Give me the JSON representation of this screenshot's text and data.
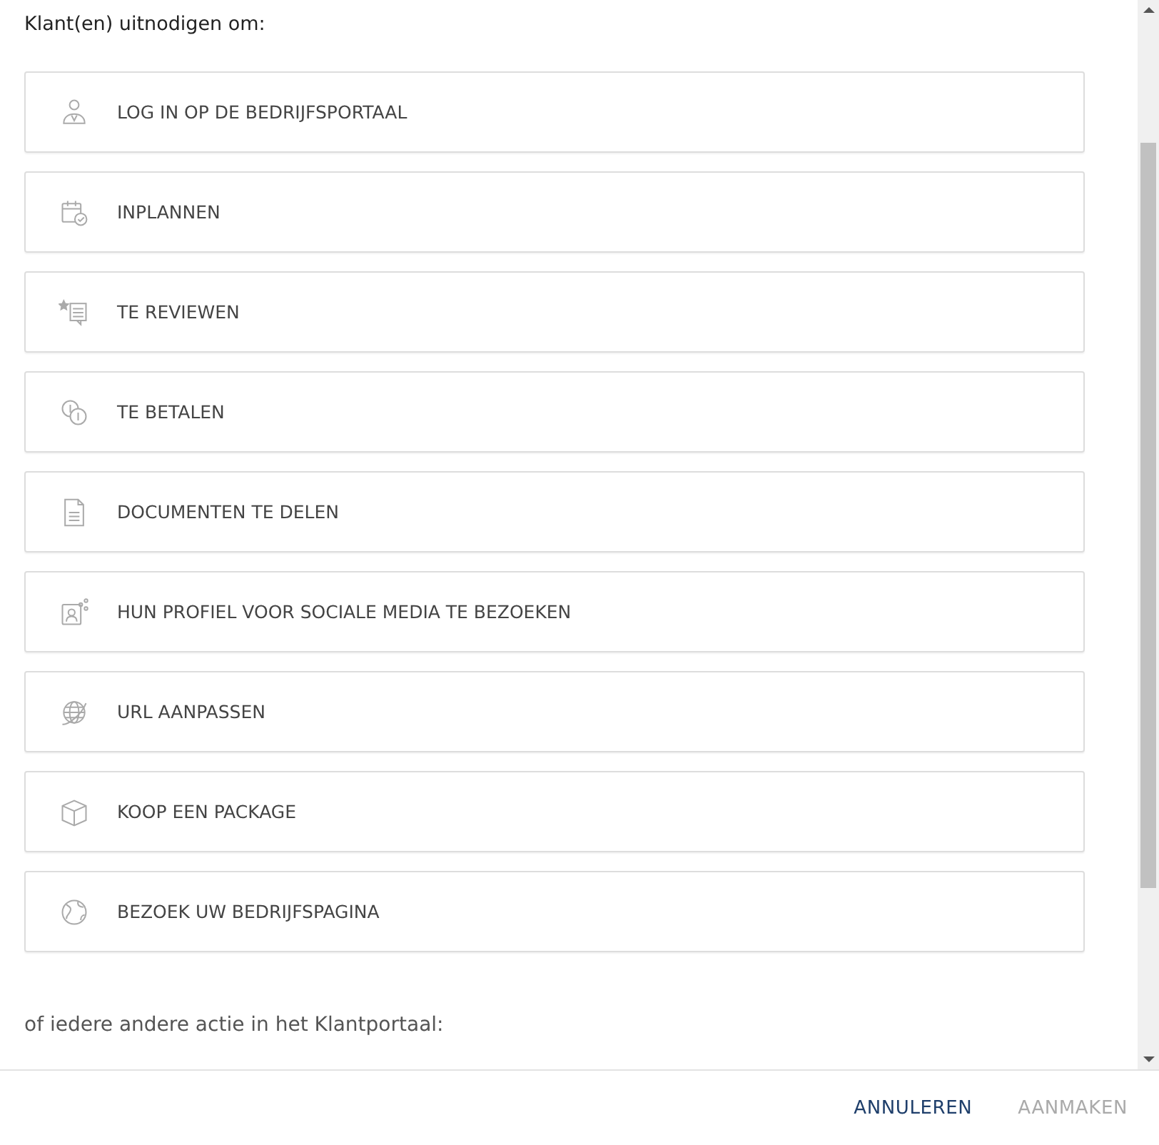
{
  "heading": "Klant(en) uitnodigen om:",
  "actions": [
    {
      "label": "LOG IN OP DE BEDRIJFSPORTAAL",
      "kind": "person"
    },
    {
      "label": "INPLANNEN",
      "kind": "calendar"
    },
    {
      "label": "TE REVIEWEN",
      "kind": "review"
    },
    {
      "label": "TE BETALEN",
      "kind": "coins"
    },
    {
      "label": "DOCUMENTEN TE DELEN",
      "kind": "document"
    },
    {
      "label": "HUN PROFIEL VOOR SOCIALE MEDIA TE BEZOEKEN",
      "kind": "profile"
    },
    {
      "label": "URL AANPASSEN",
      "kind": "web"
    },
    {
      "label": "KOOP EEN PACKAGE",
      "kind": "box"
    },
    {
      "label": "BEZOEK UW BEDRIJFSPAGINA",
      "kind": "globe"
    }
  ],
  "other_text": "of iedere andere actie in het Klantportaal:",
  "buttons": [
    {
      "label": "ANNULEREN",
      "disabled": false
    },
    {
      "label": "AANMAKEN",
      "disabled": true
    }
  ]
}
